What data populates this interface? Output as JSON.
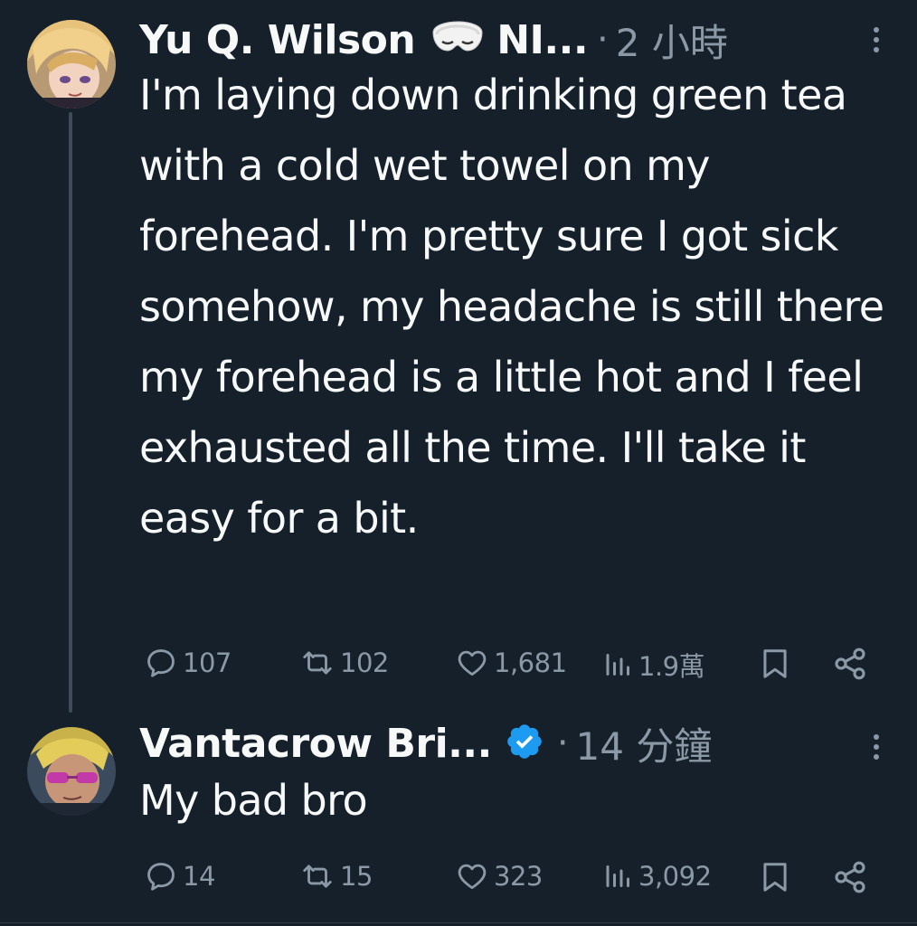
{
  "tweets": [
    {
      "author": "Yu Q. Wilson",
      "author_suffix": "NI...",
      "time": "2 小時",
      "text": "I'm laying down drinking green tea with a cold wet towel on my forehead. I'm pretty sure I got sick somehow, my headache is still there my forehead is a little hot and I feel exhausted all the time. I'll take it easy for a bit.",
      "stats": {
        "replies": "107",
        "retweets": "102",
        "likes": "1,681",
        "views": "1.9萬"
      }
    },
    {
      "author": "Vantacrow Bri...",
      "time": "14 分鐘",
      "text": "My bad bro",
      "stats": {
        "replies": "14",
        "retweets": "15",
        "likes": "323",
        "views": "3,092"
      }
    }
  ],
  "colors": {
    "background": "#15202b",
    "text_primary": "#f7f9f9",
    "text_secondary": "#8b98a5",
    "verified_blue": "#1d9bf0",
    "thread_line": "#3e4b59"
  },
  "icons": {
    "sleep_mask": "sleep-mask-emoji",
    "verified": "verified-badge-icon",
    "reply": "reply-icon",
    "retweet": "retweet-icon",
    "like": "heart-icon",
    "views": "views-icon",
    "bookmark": "bookmark-icon",
    "share": "share-icon",
    "more": "more-options-icon"
  }
}
